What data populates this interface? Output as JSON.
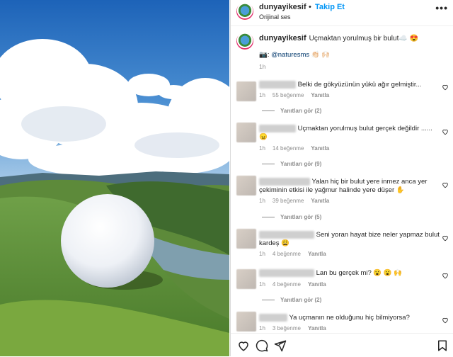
{
  "header": {
    "username": "dunyayikesif",
    "separator": "•",
    "follow_label": "Takip Et",
    "audio_label": "Orijinal ses",
    "more_label": "•••"
  },
  "caption": {
    "username": "dunyayikesif",
    "text": "Uçmaktan yorulmuş bir bulut☁️ 😍",
    "credit_prefix": "📷: ",
    "credit_handle": "@naturesms",
    "credit_suffix": " 👏🏻 🙌🏻",
    "time": "1h"
  },
  "comments": [
    {
      "text": "Belki de gökyüzünün yükü ağır gelmiştir...",
      "time": "1h",
      "likes": "55 beğenme",
      "reply": "Yanıtla",
      "replies": "Yanıtları gör (2)"
    },
    {
      "text": "Uçmaktan yorulmuş bulut gerçek değildir ...... 😠",
      "time": "1h",
      "likes": "14 beğenme",
      "reply": "Yanıtla",
      "replies": "Yanıtları gör (9)"
    },
    {
      "text": "Yalan hiç bir bulut yere inmez anca yer çekiminin etkisi ile yağmur halinde yere düşer ✋",
      "time": "1h",
      "likes": "39 beğenme",
      "reply": "Yanıtla",
      "replies": "Yanıtları gör (5)"
    },
    {
      "text": "Seni yoran hayat bize neler yapmaz bulut kardeş 😩",
      "time": "1h",
      "likes": "4 beğenme",
      "reply": "Yanıtla",
      "replies": ""
    },
    {
      "text": "Lan bu gerçek mi? 😮 😮 🙌",
      "time": "1h",
      "likes": "4 beğenme",
      "reply": "Yanıtla",
      "replies": "Yanıtları gör (2)"
    },
    {
      "text": "Ya uçmanın ne olduğunu hiç bilmiyorsa?",
      "time": "1h",
      "likes": "3 beğenme",
      "reply": "Yanıtla",
      "replies": ""
    }
  ]
}
